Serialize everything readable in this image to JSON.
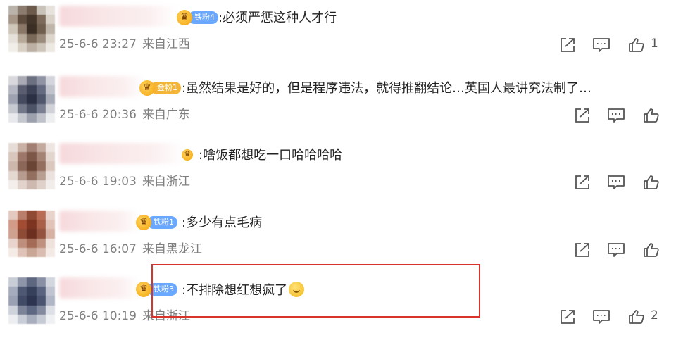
{
  "colors": {
    "accent_red": "#d9342b",
    "badge_blue": "#6aa8ff",
    "badge_gold": "#f4b536",
    "meta_gray": "#7f7f7f"
  },
  "comments": [
    {
      "badge": "铁粉4",
      "badge_color": "blue",
      "text": ":必须严惩这种人才行",
      "time": "25-6-6 23:27",
      "location": "来自江西",
      "likes": "1",
      "avatar": [
        "#b9b3ab",
        "#8b7a6e",
        "#6c5a4c",
        "#c8c2b8",
        "#e7e2dc",
        "#a59688",
        "#5d4b3e",
        "#433529",
        "#7d6a5b",
        "#d8d1c7",
        "#cfc6ba",
        "#8a7768",
        "#3b2f25",
        "#6f5d4e",
        "#bfb5a8",
        "#e5e0da",
        "#b6a99a",
        "#7a6959",
        "#9a8b7c",
        "#dcd5cc",
        "#f1eee9",
        "#d8d0c5",
        "#bbb0a3",
        "#cdc5ba",
        "#ece8e2"
      ]
    },
    {
      "badge": "金粉1",
      "badge_color": "gold",
      "text": ":虽然结果是好的，但是程序违法，就得推翻结论…英国人最讲究法制了…",
      "time": "25-6-6 20:36",
      "location": "来自广东",
      "likes": "",
      "avatar": [
        "#d9d9dd",
        "#a9aab3",
        "#6d7080",
        "#8f93a3",
        "#d4d5dc",
        "#b5b7c2",
        "#595d6f",
        "#3d4155",
        "#646a80",
        "#c0c2cc",
        "#9ea1b0",
        "#454a5e",
        "#2c3044",
        "#50566c",
        "#a7abb8",
        "#c7c9d1",
        "#737889",
        "#4e5467",
        "#7a8092",
        "#d0d2d8",
        "#e8e9ec",
        "#c5c7cf",
        "#9da1ae",
        "#bfc2cb",
        "#eceef0"
      ]
    },
    {
      "badge": "",
      "badge_color": "gold",
      "text": ":啥饭都想吃一口哈哈哈哈",
      "time": "25-6-6 19:03",
      "location": "来自浙江",
      "likes": "",
      "avatar": [
        "#e7ddd8",
        "#c9b1a6",
        "#a17f72",
        "#c4aa9e",
        "#ece5e1",
        "#d9c6bd",
        "#9d786a",
        "#7c5748",
        "#a48375",
        "#e2d5ce",
        "#cdb7ad",
        "#8a6758",
        "#6a4536",
        "#946e5f",
        "#dac8bf",
        "#e4d8d1",
        "#b79b8f",
        "#936f60",
        "#b89d91",
        "#ebe2dd",
        "#f3eeeb",
        "#e1d3cc",
        "#cdb9b0",
        "#dfd1ca",
        "#f2ecea"
      ]
    },
    {
      "badge": "铁粉1",
      "badge_color": "blue",
      "text": ":多少有点毛病",
      "time": "25-6-6 16:07",
      "location": "来自黑龙江",
      "likes": "",
      "avatar": [
        "#e4c9c0",
        "#b97f6c",
        "#8f4a36",
        "#b86c55",
        "#e7d3cc",
        "#d39c88",
        "#a24c33",
        "#7d3522",
        "#a95f48",
        "#e2c3b8",
        "#cfa18f",
        "#8d4a35",
        "#6d3020",
        "#93533e",
        "#d7b2a4",
        "#e8d4cc",
        "#bf8f7d",
        "#a46b57",
        "#c0907e",
        "#efe1db",
        "#f4ebe7",
        "#dfc3b8",
        "#caa696",
        "#dbbcb0",
        "#f3e9e5"
      ]
    },
    {
      "badge": "铁粉3",
      "badge_color": "blue",
      "text": ":不排除想红想疯了",
      "time": "25-6-6 10:19",
      "location": "来自浙江",
      "likes": "2",
      "avatar": [
        "#c9cdd6",
        "#8e95a8",
        "#5e6780",
        "#8990a6",
        "#d2d6de",
        "#a5acbd",
        "#4f5873",
        "#37405b",
        "#5a6480",
        "#bfc4d0",
        "#9aa1b4",
        "#424b66",
        "#2c3450",
        "#4b5571",
        "#b0b6c5",
        "#cfd3dc",
        "#7d8499",
        "#5f6883",
        "#838aa0",
        "#dde0e6",
        "#eceef2",
        "#c9cdd7",
        "#a8aebd",
        "#c5cad5",
        "#eef0f3"
      ]
    }
  ],
  "icons": {
    "share": "share-icon",
    "reply": "comment-icon",
    "like": "thumbs-up-icon"
  }
}
